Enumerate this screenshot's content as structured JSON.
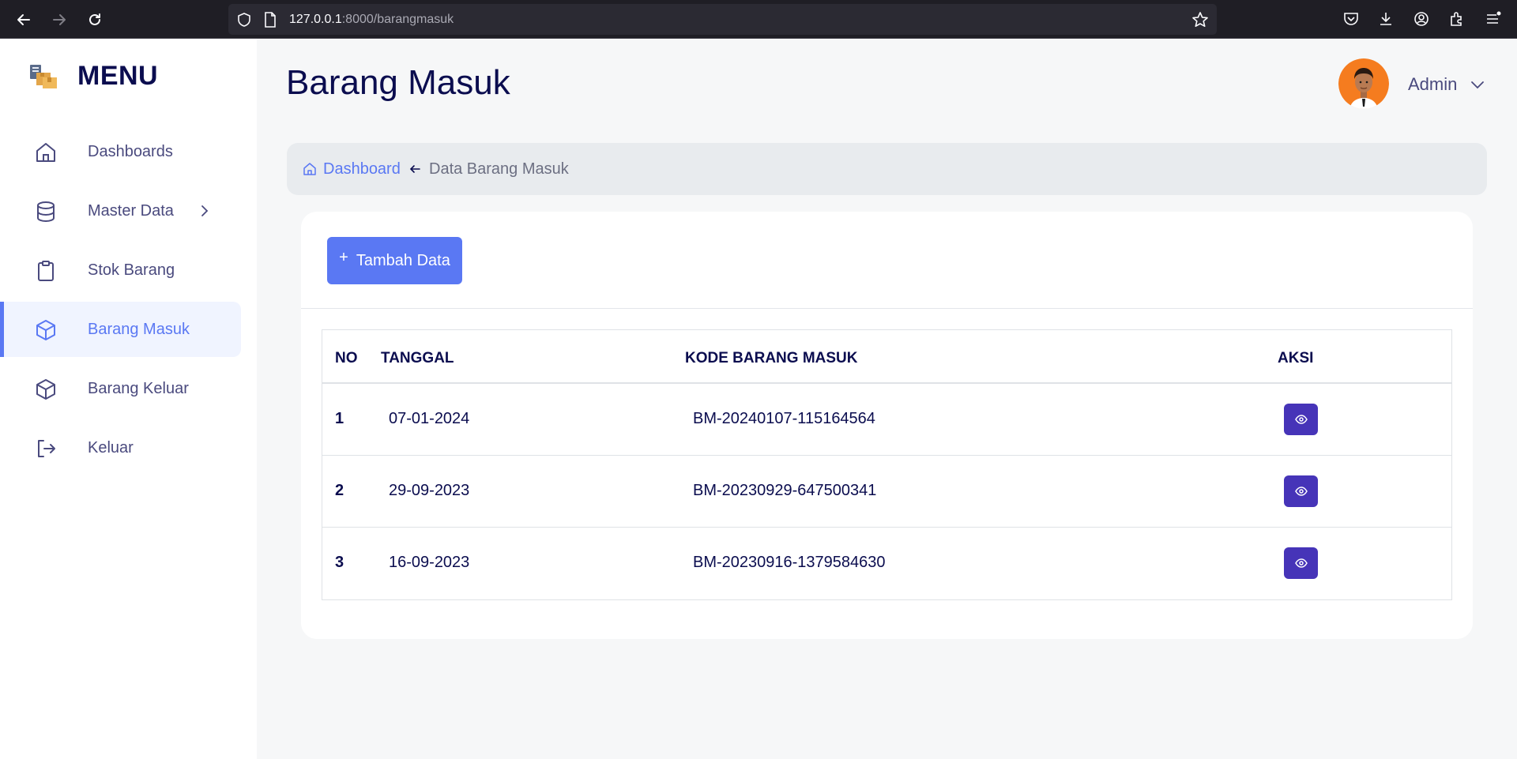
{
  "browser": {
    "url_host": "127.0.0.1",
    "url_rest": ":8000/barangmasuk"
  },
  "sidebar": {
    "brand": "MENU",
    "items": [
      {
        "label": "Dashboards",
        "icon": "home-icon"
      },
      {
        "label": "Master Data",
        "icon": "database-icon",
        "has_submenu": true
      },
      {
        "label": "Stok Barang",
        "icon": "clipboard-icon"
      },
      {
        "label": "Barang Masuk",
        "icon": "box-icon",
        "active": true
      },
      {
        "label": "Barang Keluar",
        "icon": "box-icon"
      },
      {
        "label": "Keluar",
        "icon": "logout-icon"
      }
    ]
  },
  "header": {
    "title": "Barang Masuk",
    "user_name": "Admin"
  },
  "breadcrumb": {
    "home": "Dashboard",
    "current": "Data Barang Masuk"
  },
  "card": {
    "add_button_label": "Tambah Data",
    "table": {
      "columns": [
        "NO",
        "TANGGAL",
        "KODE BARANG MASUK",
        "AKSI"
      ],
      "rows": [
        {
          "no": "1",
          "tanggal": "07-01-2024",
          "kode": "BM-20240107-115164564"
        },
        {
          "no": "2",
          "tanggal": "29-09-2023",
          "kode": "BM-20230929-647500341"
        },
        {
          "no": "3",
          "tanggal": "16-09-2023",
          "kode": "BM-20230916-1379584630"
        }
      ]
    }
  },
  "colors": {
    "accent": "#5a78f3",
    "view_button": "#4634b8",
    "title": "#0b0d4f"
  }
}
